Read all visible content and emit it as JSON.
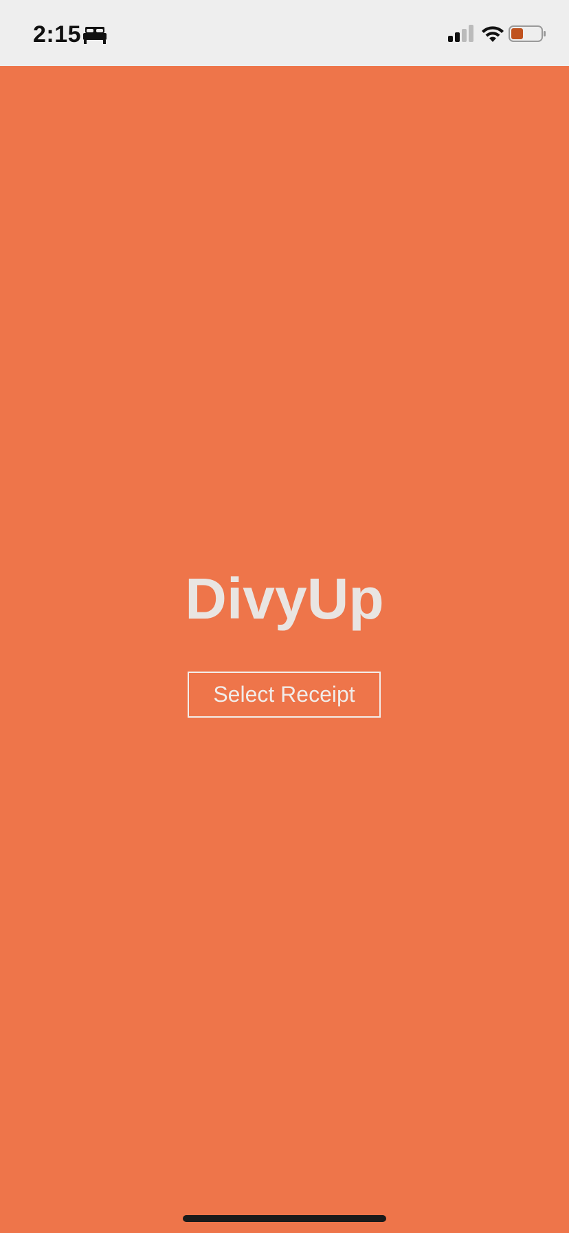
{
  "status_bar": {
    "time": "2:15",
    "sleep_icon": "bed-icon",
    "signal_icon": "cellular-signal-icon",
    "wifi_icon": "wifi-icon",
    "battery_icon": "battery-icon",
    "battery_level": 0.25,
    "battery_color": "#C0521E"
  },
  "app": {
    "title": "DivyUp",
    "select_receipt_label": "Select Receipt"
  },
  "colors": {
    "background": "#EE754A",
    "status_bar_background": "#EEEEEE",
    "title_text": "#E9E5E2",
    "button_border": "#F3EEEB"
  }
}
